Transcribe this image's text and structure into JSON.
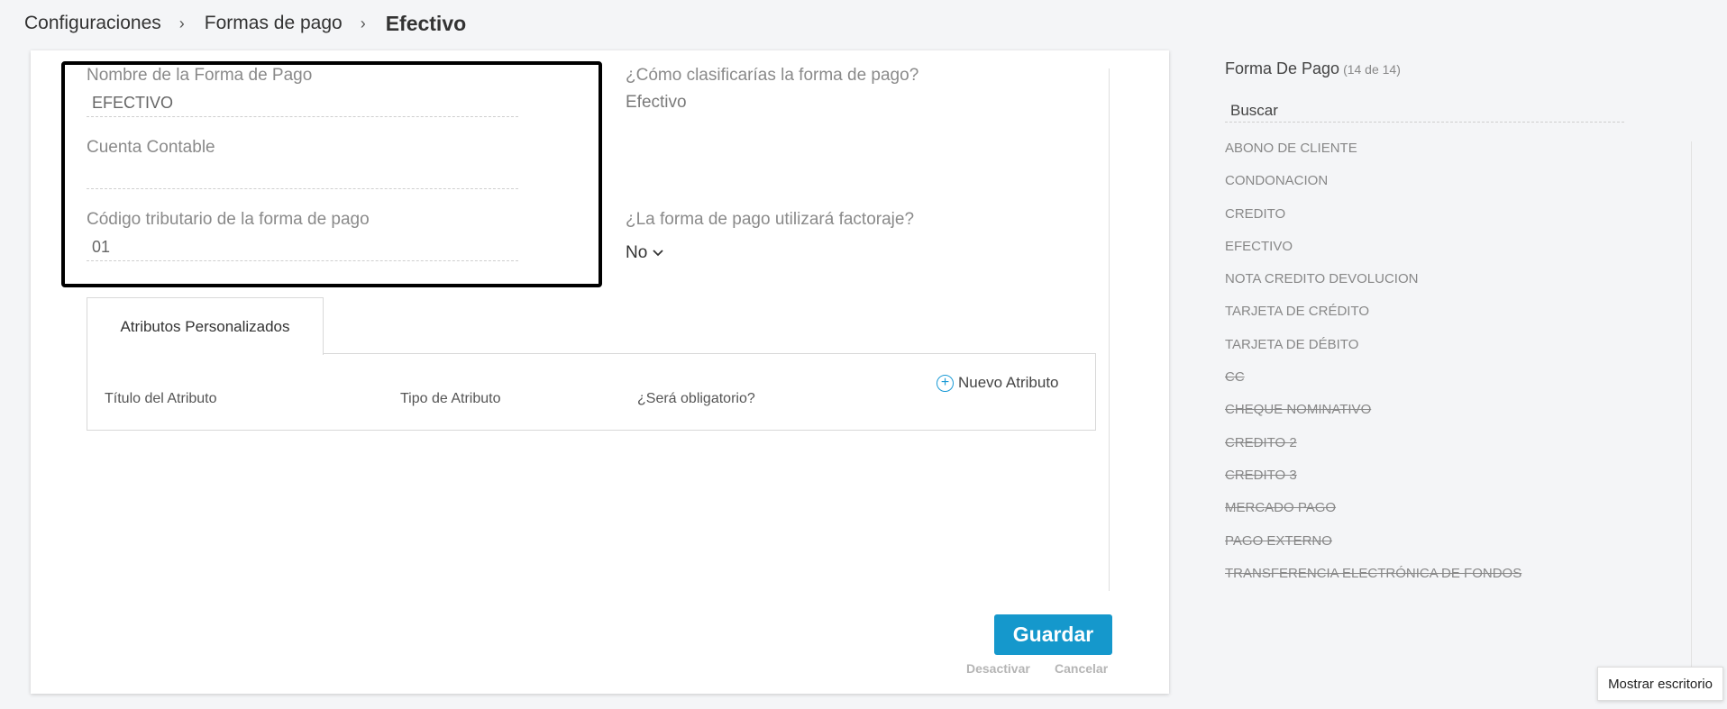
{
  "breadcrumb": {
    "items": [
      "Configuraciones",
      "Formas de pago"
    ],
    "current": "Efectivo",
    "separator": "›"
  },
  "form": {
    "name_label": "Nombre de la Forma de Pago",
    "name_value": "EFECTIVO",
    "account_label": "Cuenta Contable",
    "account_value": "",
    "tax_code_label": "Código tributario de la forma de pago",
    "tax_code_value": "01",
    "classify_label": "¿Cómo clasificarías la forma de pago?",
    "classify_value": "Efectivo",
    "factoring_label": "¿La forma de pago utilizará factoraje?",
    "factoring_value": "No"
  },
  "attributes": {
    "tab_label": "Atributos Personalizados",
    "columns": [
      "Título del Atributo",
      "Tipo de Atributo",
      "¿Será obligatorio?"
    ],
    "new_button": "Nuevo Atributo"
  },
  "actions": {
    "save": "Guardar",
    "deactivate": "Desactivar",
    "cancel": "Cancelar"
  },
  "sidebar": {
    "title": "Forma De Pago",
    "count": "(14 de 14)",
    "search_placeholder": "Buscar",
    "items": [
      {
        "label": "ABONO DE CLIENTE",
        "active": true
      },
      {
        "label": "CONDONACION",
        "active": true
      },
      {
        "label": "CREDITO",
        "active": true
      },
      {
        "label": "EFECTIVO",
        "active": true
      },
      {
        "label": "NOTA CREDITO DEVOLUCION",
        "active": true
      },
      {
        "label": "TARJETA DE CRÉDITO",
        "active": true
      },
      {
        "label": "TARJETA DE DÉBITO",
        "active": true
      },
      {
        "label": "CC",
        "active": false
      },
      {
        "label": "CHEQUE NOMINATIVO",
        "active": false
      },
      {
        "label": "CREDITO 2",
        "active": false
      },
      {
        "label": "CREDITO 3",
        "active": false
      },
      {
        "label": "MERCADO PAGO",
        "active": false
      },
      {
        "label": "PAGO EXTERNO",
        "active": false
      },
      {
        "label": "TRANSFERENCIA ELECTRÓNICA DE FONDOS",
        "active": false
      }
    ]
  },
  "tooltip": {
    "text": "Mostrar escritorio"
  },
  "colors": {
    "accent": "#1598cc",
    "highlight_border": "#000000"
  }
}
